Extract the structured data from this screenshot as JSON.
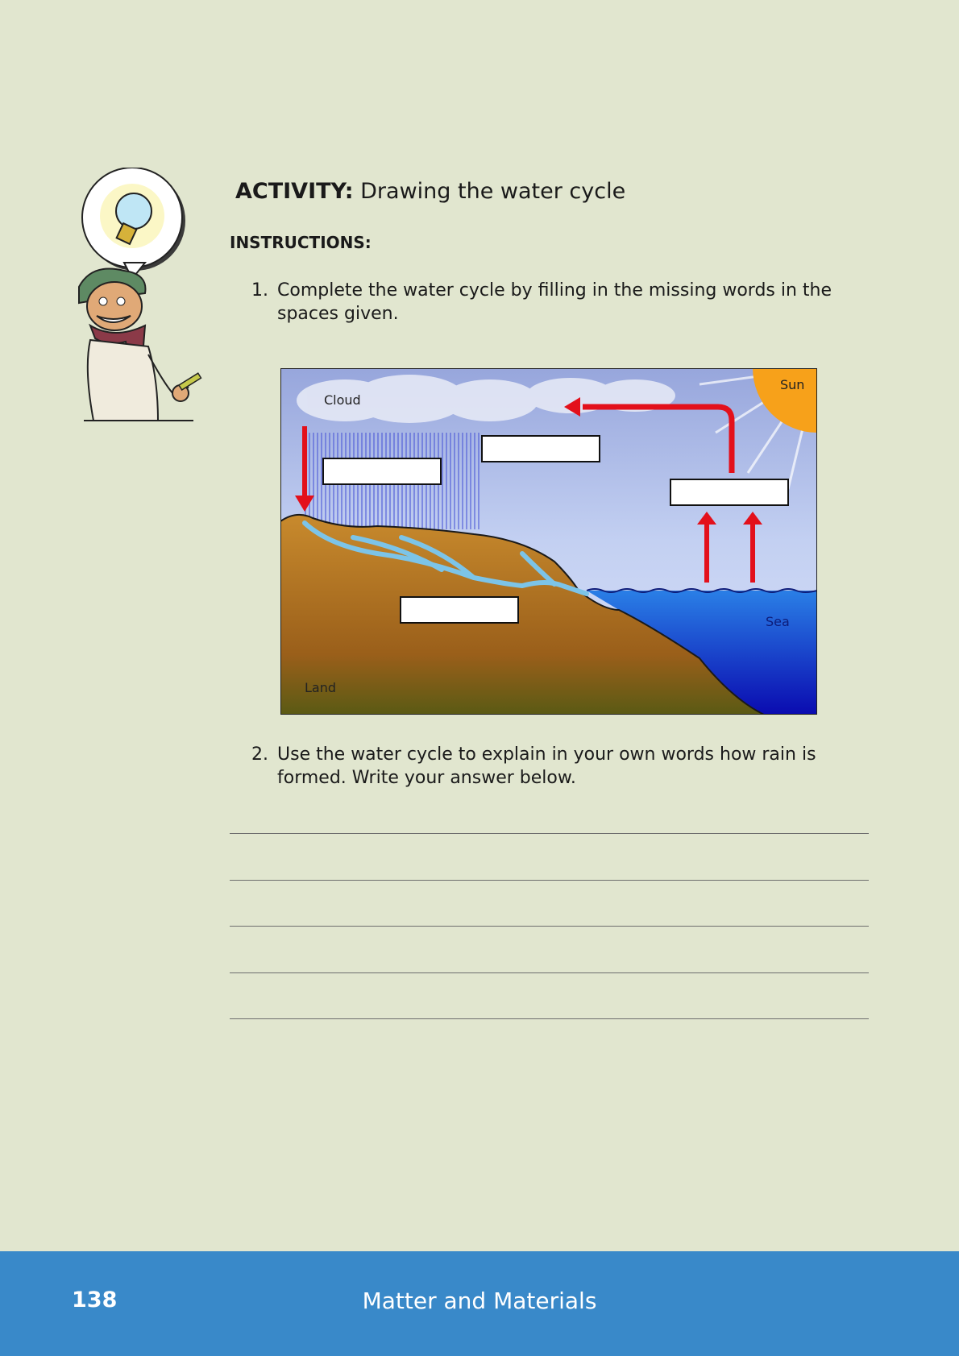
{
  "activity": {
    "label": "ACTIVITY:",
    "title": "Drawing the water cycle"
  },
  "instructions_heading": "INSTRUCTIONS:",
  "questions": [
    {
      "number": "1.",
      "text": "Complete the water cycle by filling in the missing words in the spaces given."
    },
    {
      "number": "2.",
      "text": "Use the water cycle to explain in your own words how rain is formed. Write your answer below."
    }
  ],
  "diagram": {
    "labels": {
      "cloud": "Cloud",
      "sun": "Sun",
      "sea": "Sea",
      "land": "Land"
    },
    "blank_boxes": 4
  },
  "answer_lines": 5,
  "footer": {
    "page_number": "138",
    "title": "Matter and Materials"
  },
  "colors": {
    "page_background": "#e1e6cf",
    "footer_background": "#3989c9",
    "arrow": "#e3101b",
    "sea": "#1c4fd6",
    "land": "#a86c1f",
    "sun": "#f7a11a"
  }
}
